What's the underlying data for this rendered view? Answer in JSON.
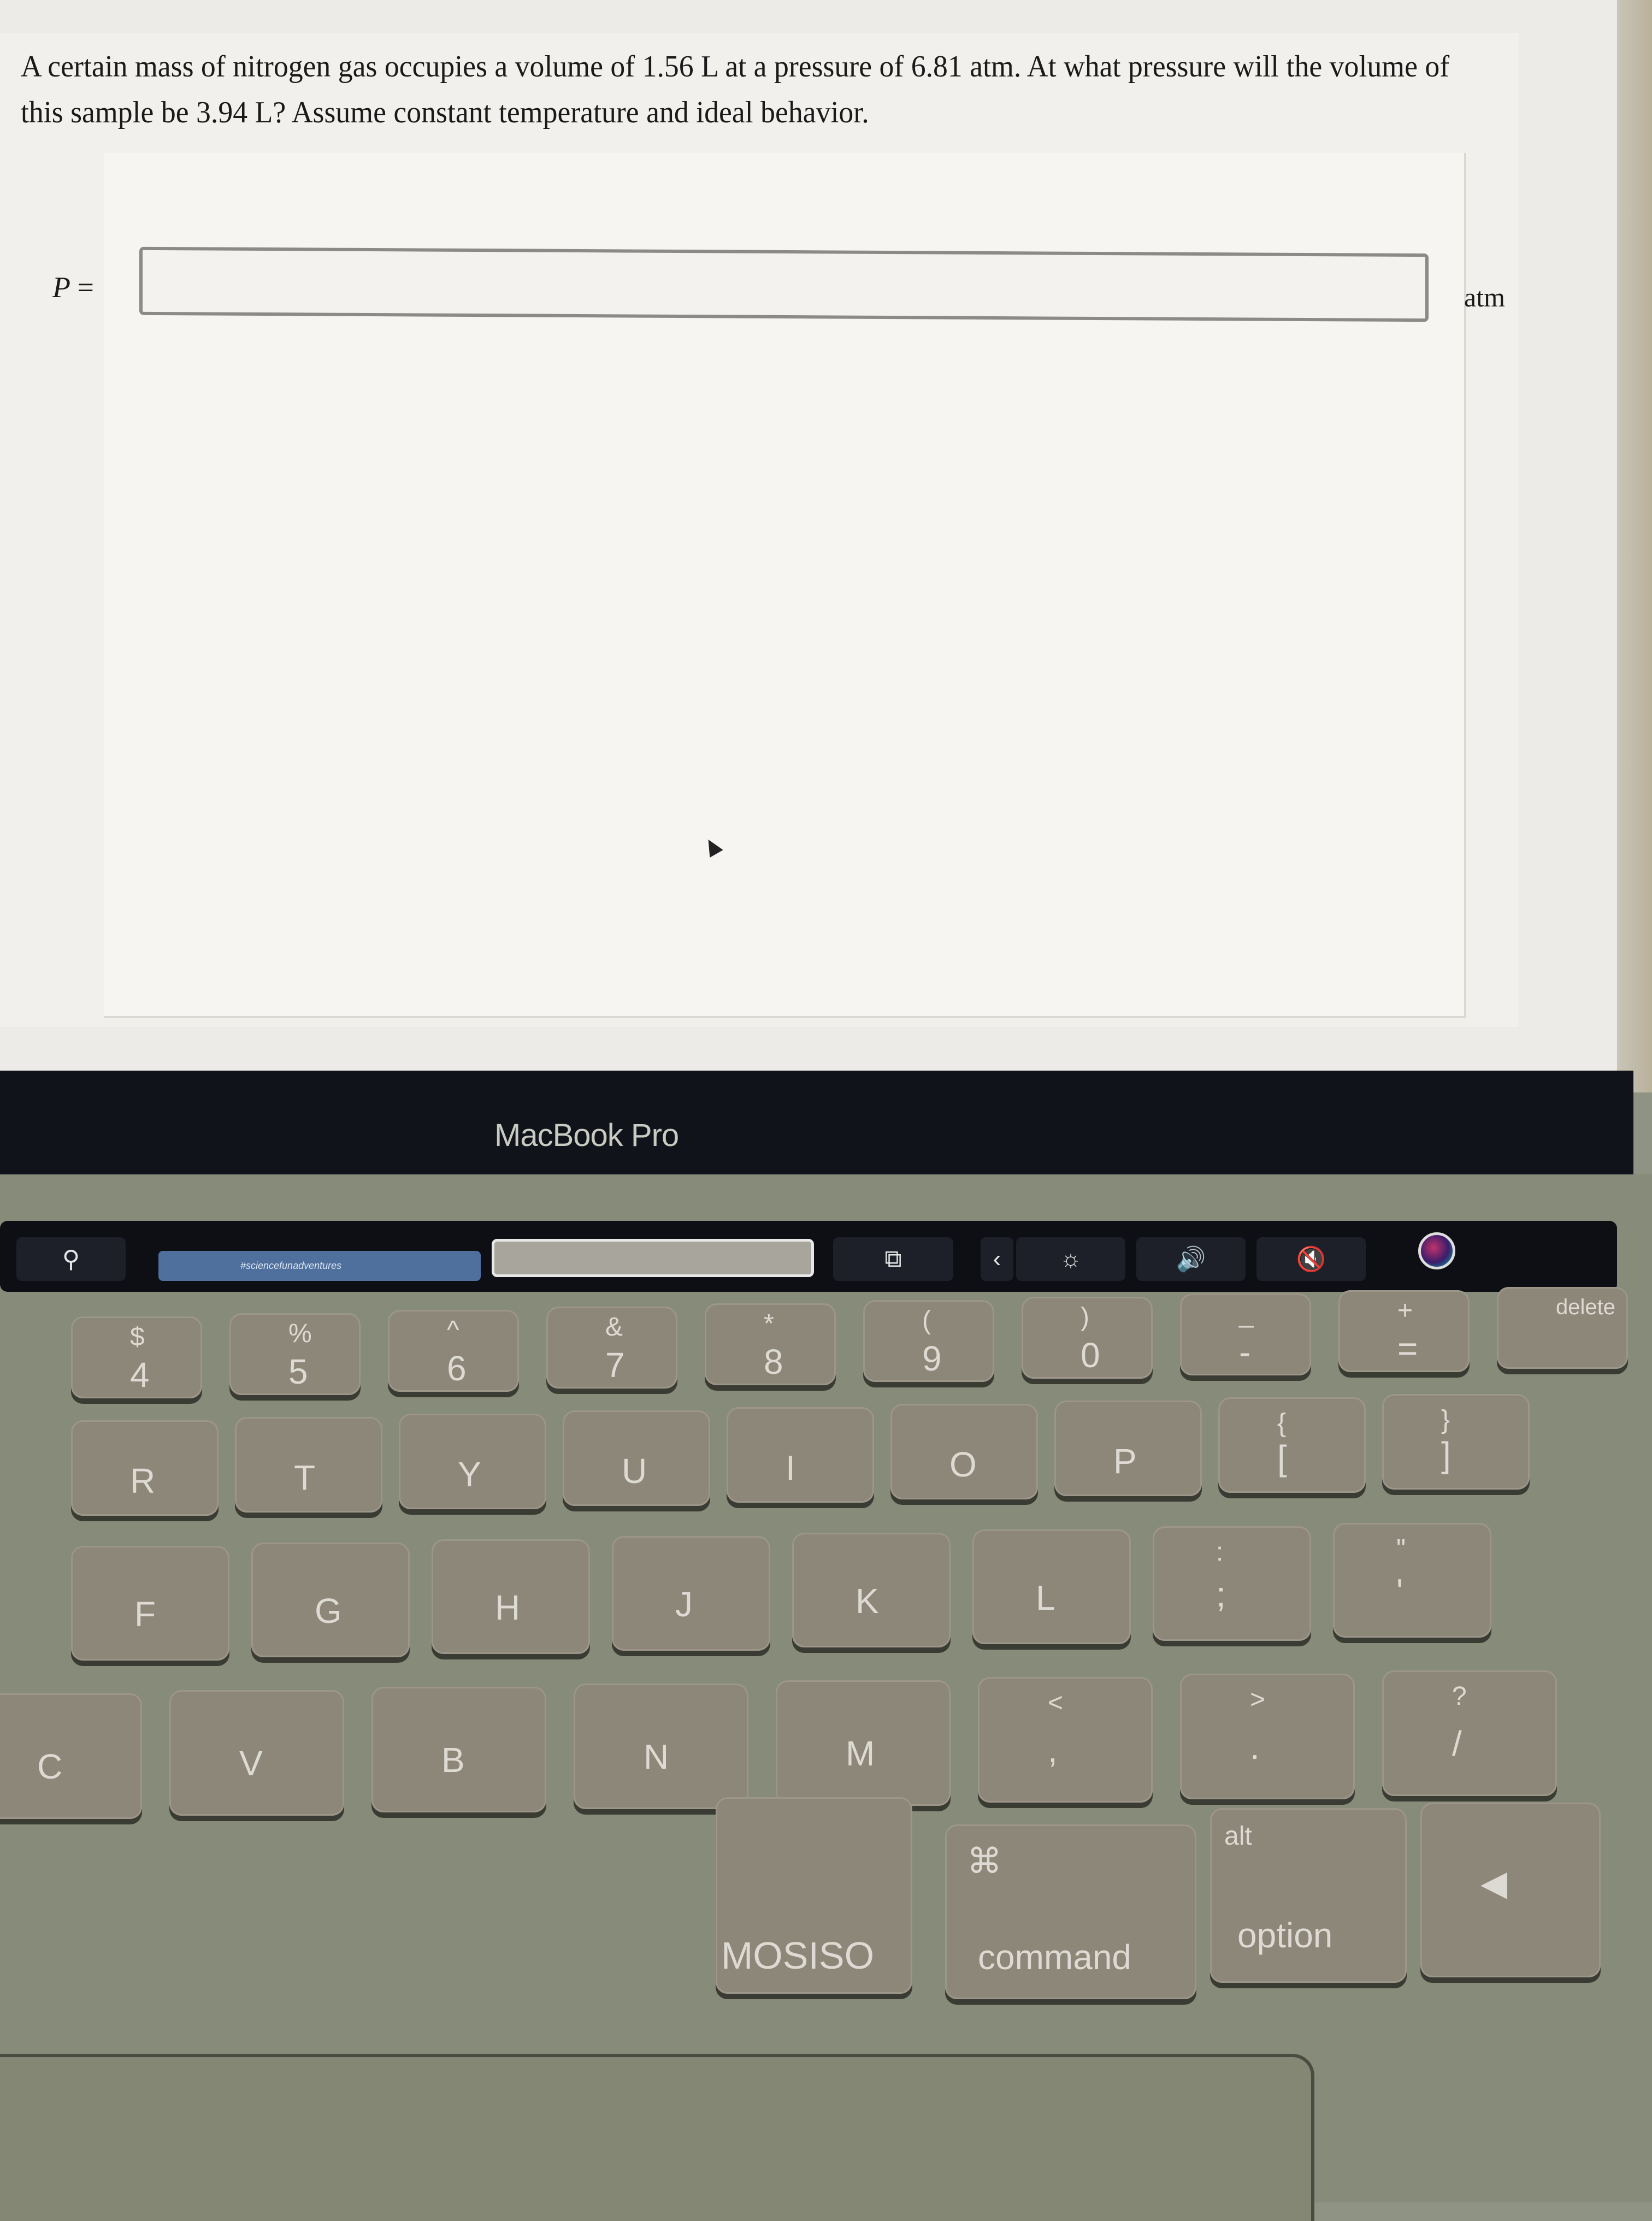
{
  "question": {
    "text": "A certain mass of nitrogen gas occupies a volume of 1.56 L at a pressure of 6.81 atm. At what pressure will the volume of this sample be 3.94 L? Assume constant temperature and ideal behavior."
  },
  "answer": {
    "variable": "P",
    "equals": "=",
    "value": "",
    "unit": "atm"
  },
  "device": {
    "brand_label": "MacBook Pro"
  },
  "touch_bar": {
    "items": [
      {
        "icon": "search-icon",
        "glyph": "⚲"
      },
      {
        "icon": "screenshot-preview",
        "text": "#sciencefunadventures"
      },
      {
        "icon": "blank-field"
      },
      {
        "icon": "new-tab-icon",
        "glyph": "⧉"
      },
      {
        "icon": "collapse-chevron-icon",
        "glyph": "‹"
      },
      {
        "icon": "brightness-icon",
        "glyph": "☼"
      },
      {
        "icon": "volume-icon",
        "glyph": "🔊"
      },
      {
        "icon": "mute-icon",
        "glyph": "🔇"
      },
      {
        "icon": "siri-icon"
      }
    ]
  },
  "keyboard": {
    "row_numbers": [
      {
        "main": "4",
        "sub": "$"
      },
      {
        "main": "5",
        "sub": "%"
      },
      {
        "main": "6",
        "sub": "^"
      },
      {
        "main": "7",
        "sub": "&"
      },
      {
        "main": "8",
        "sub": "*"
      },
      {
        "main": "9",
        "sub": "("
      },
      {
        "main": "0",
        "sub": ")"
      },
      {
        "main": "-",
        "sub": "_"
      },
      {
        "main": "=",
        "sub": "+"
      },
      {
        "main": "delete",
        "sub": ""
      }
    ],
    "row_top": [
      "R",
      "T",
      "Y",
      "U",
      "I",
      "O",
      "P",
      "[",
      "]"
    ],
    "row_top_sub": [
      "",
      "",
      "",
      "",
      "",
      "",
      "",
      "{",
      "}"
    ],
    "row_home": [
      "F",
      "G",
      "H",
      "J",
      "K",
      "L",
      ";",
      "'"
    ],
    "row_home_sub": [
      "",
      "",
      "",
      "",
      "",
      "",
      ":",
      "\""
    ],
    "row_bottom": [
      "C",
      "V",
      "B",
      "N",
      "M",
      ",",
      ".",
      "/"
    ],
    "row_bottom_sub": [
      "",
      "",
      "",
      "",
      "",
      "<",
      ">",
      "?"
    ],
    "space_label": "MOSISO",
    "command": {
      "symbol": "⌘",
      "label": "command"
    },
    "option": {
      "sub": "alt",
      "label": "option"
    },
    "arrow_left": "◀"
  }
}
